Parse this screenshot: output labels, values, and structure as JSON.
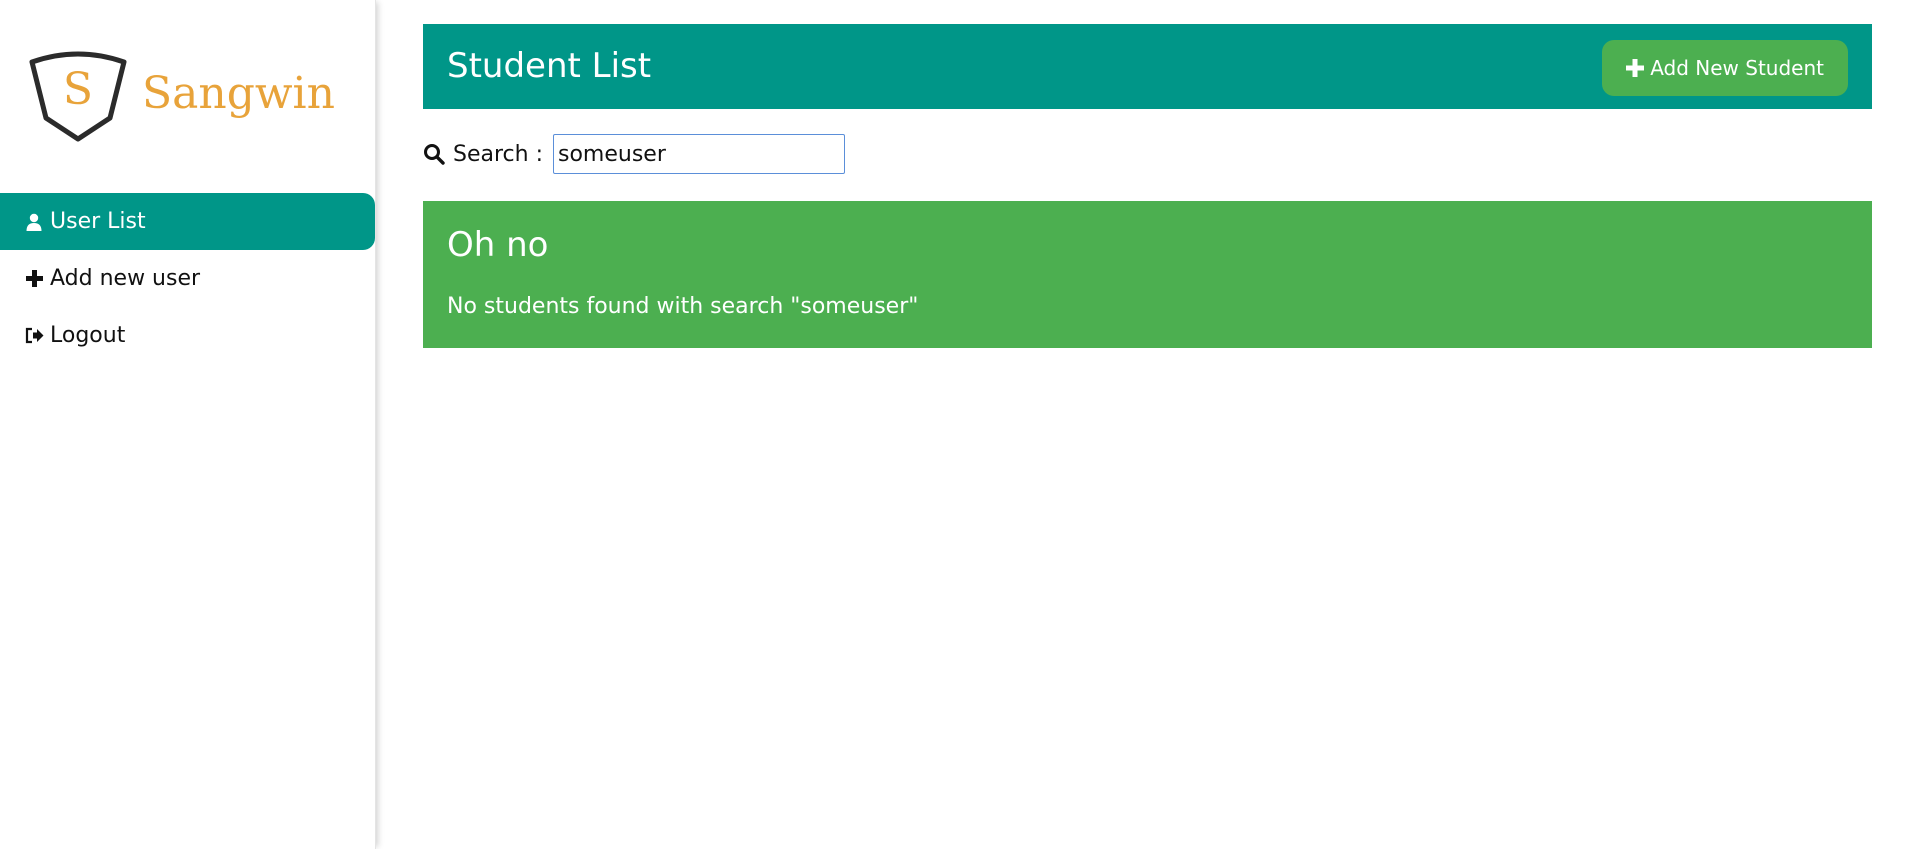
{
  "brand": {
    "letter": "S",
    "name": "Sangwin",
    "color": "#e8a33a"
  },
  "sidebar": {
    "items": [
      {
        "label": "User List",
        "icon": "user-icon",
        "active": true
      },
      {
        "label": "Add new user",
        "icon": "plus-icon",
        "active": false
      },
      {
        "label": "Logout",
        "icon": "sign-out-icon",
        "active": false
      }
    ]
  },
  "header": {
    "title": "Student List",
    "add_button_label": "Add New Student"
  },
  "search": {
    "label": "Search :",
    "value": "someuser"
  },
  "alert": {
    "title": "Oh no",
    "message": "No students found with search \"someuser\""
  },
  "colors": {
    "primary": "#009688",
    "success": "#4caf50",
    "accent": "#e8a33a"
  }
}
